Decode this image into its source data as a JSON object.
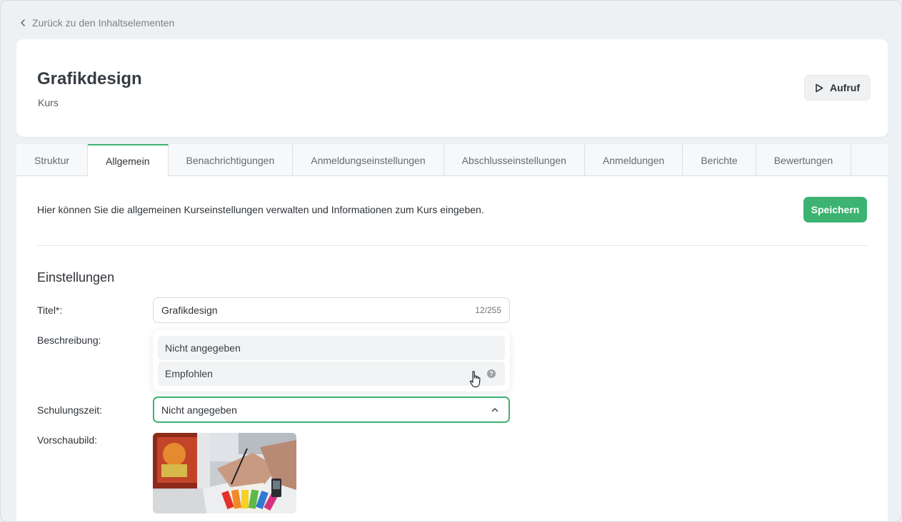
{
  "nav": {
    "back_label": "Zurück zu den Inhaltselementen"
  },
  "header": {
    "title": "Grafikdesign",
    "subtitle": "Kurs",
    "launch_label": "Aufruf"
  },
  "tabs": [
    {
      "label": "Struktur"
    },
    {
      "label": "Allgemein",
      "active": true
    },
    {
      "label": "Benachrichtigungen"
    },
    {
      "label": "Anmeldungseinstellungen"
    },
    {
      "label": "Abschlusseinstellungen"
    },
    {
      "label": "Anmeldungen"
    },
    {
      "label": "Berichte"
    },
    {
      "label": "Bewertungen"
    }
  ],
  "content": {
    "intro": "Hier können Sie die allgemeinen Kurseinstellungen verwalten und Informationen zum Kurs eingeben.",
    "save_label": "Speichern",
    "section_title": "Einstellungen"
  },
  "form": {
    "title_label": "Titel*:",
    "title_value": "Grafikdesign",
    "title_counter": "12/255",
    "description_label": "Beschreibung:",
    "training_time_label": "Schulungszeit:",
    "training_time_value": "Nicht angegeben",
    "preview_label": "Vorschaubild:",
    "dropdown_options": [
      "Nicht angegeben",
      "Empfohlen"
    ]
  },
  "colors": {
    "accent": "#3cb371",
    "background": "#eef1f4"
  }
}
